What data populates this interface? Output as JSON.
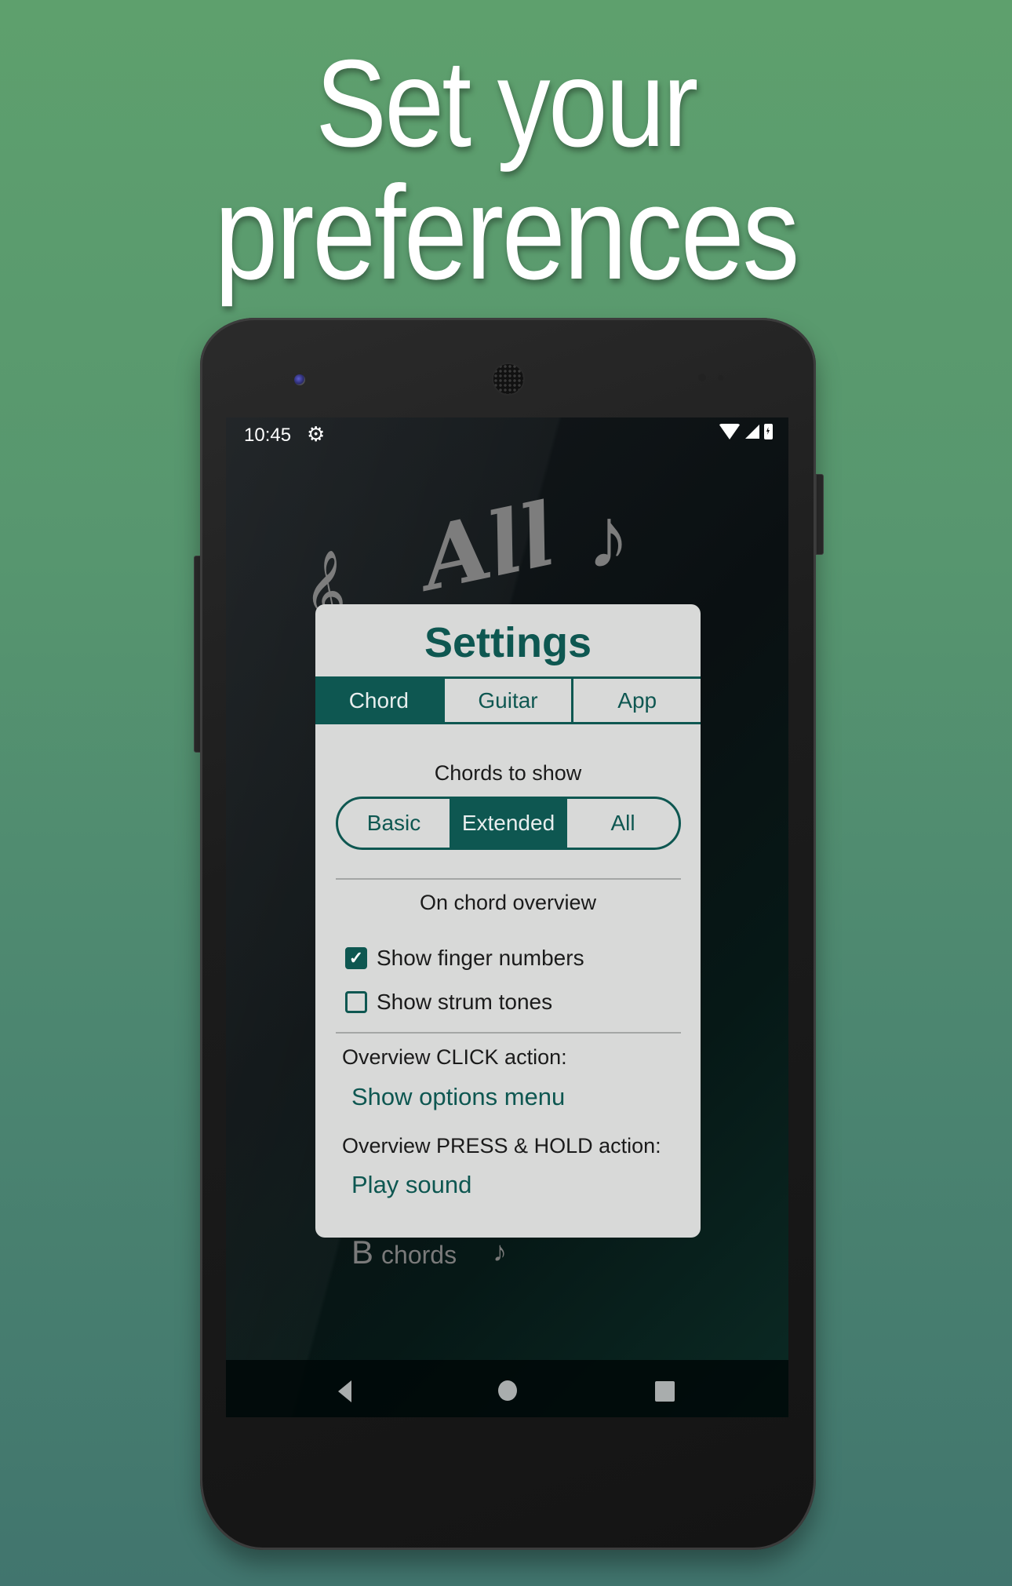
{
  "headline": {
    "line1": "Set your",
    "line2": "preferences"
  },
  "status_bar": {
    "time": "10:45",
    "left_icon": "gear-icon",
    "right_icons": [
      "wifi-icon",
      "cell-signal-icon",
      "battery-charging-icon"
    ]
  },
  "background_app": {
    "logo_text": "All",
    "logo_icons": [
      "treble-clef-icon",
      "eighth-note-icon"
    ],
    "row_letter": "B",
    "row_label": "chords",
    "row_icon": "music-note-icon"
  },
  "dialog": {
    "title": "Settings",
    "tabs": [
      {
        "label": "Chord",
        "active": true
      },
      {
        "label": "Guitar",
        "active": false
      },
      {
        "label": "App",
        "active": false
      }
    ],
    "chords_to_show": {
      "label": "Chords to show",
      "options": [
        {
          "label": "Basic",
          "selected": false
        },
        {
          "label": "Extended",
          "selected": true
        },
        {
          "label": "All",
          "selected": false
        }
      ]
    },
    "overview": {
      "label": "On chord overview",
      "checkboxes": [
        {
          "label": "Show finger numbers",
          "checked": true
        },
        {
          "label": "Show strum tones",
          "checked": false
        }
      ]
    },
    "click_action": {
      "label": "Overview CLICK action:",
      "value": "Show options menu"
    },
    "hold_action": {
      "label": "Overview PRESS & HOLD action:",
      "value": "Play sound"
    }
  },
  "nav_bar": {
    "buttons": [
      "back-icon",
      "home-icon",
      "recents-icon"
    ]
  },
  "colors": {
    "accent": "#0e5751",
    "dialog_bg": "#d8d9d8",
    "bg_top": "#5ea06d",
    "bg_bottom": "#41756e"
  }
}
